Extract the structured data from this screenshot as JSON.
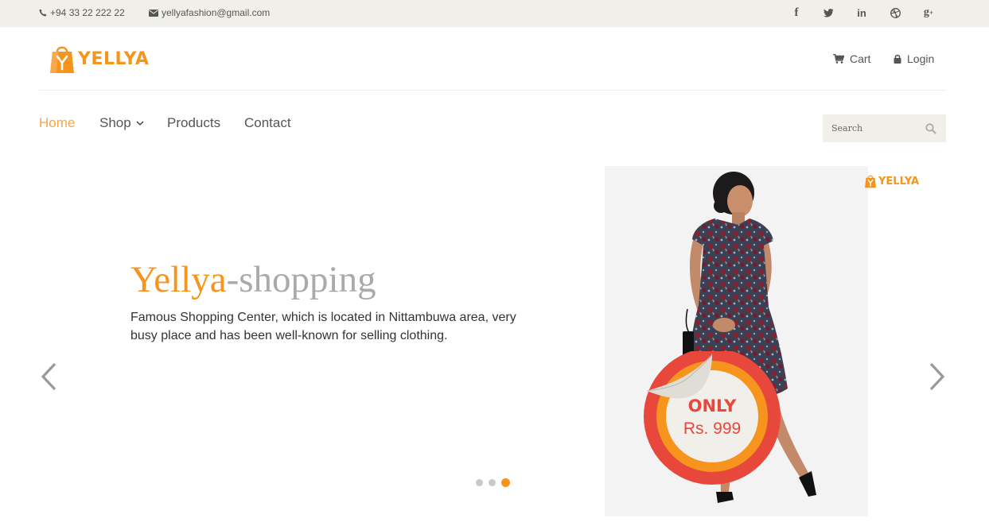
{
  "topbar": {
    "phone": "+94 33 22 222 22",
    "email": "yellyafashion@gmail.com",
    "social": [
      "facebook-icon",
      "twitter-icon",
      "linkedin-icon",
      "dribbble-icon",
      "google-plus-icon"
    ]
  },
  "brand": {
    "name": "YELLYA",
    "color": "#f7941d"
  },
  "header": {
    "cart_label": "Cart",
    "login_label": "Login"
  },
  "nav": {
    "home": "Home",
    "shop": "Shop",
    "products": "Products",
    "contact": "Contact",
    "active": "Home",
    "active_color": "#f7a545"
  },
  "search": {
    "placeholder": "Search"
  },
  "slider": {
    "title_part1": "Yellya",
    "title_part2": "-shopping",
    "description": "Famous Shopping Center, which is located in Nittambuwa area, very busy place and has been well-known for selling clothing.",
    "active_slide": 3,
    "slide_count": 3
  },
  "promo": {
    "watermark": "YELLYA",
    "only": "ONLY",
    "price": "Rs. 999",
    "badge_colors": [
      "#e8473c",
      "#f7941d",
      "#f1efe9"
    ]
  }
}
